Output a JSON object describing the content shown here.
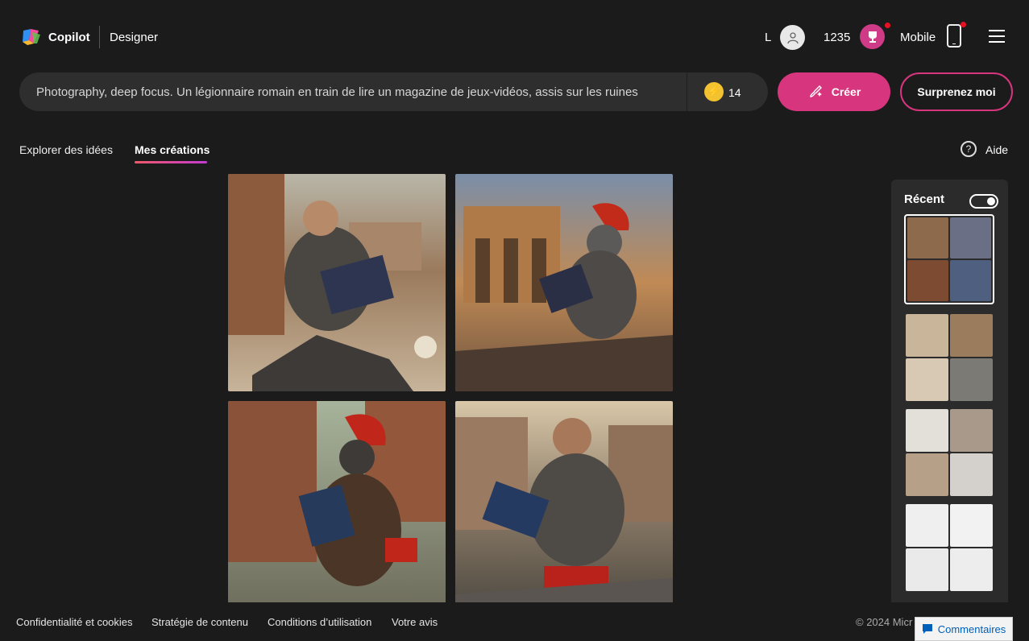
{
  "header": {
    "brand": "Copilot",
    "product": "Designer",
    "user_initial": "L",
    "points": "1235",
    "mobile_label": "Mobile"
  },
  "prompt": {
    "text": "Photography, deep focus. Un légionnaire romain en train de lire un magazine de jeux-vidéos, assis sur les ruines",
    "boosts": "14",
    "create_label": "Créer",
    "surprise_label": "Surprenez moi"
  },
  "tabs": [
    {
      "label": "Explorer des idées",
      "active": false
    },
    {
      "label": "Mes créations",
      "active": true
    }
  ],
  "help_label": "Aide",
  "recent": {
    "title": "Récent",
    "toggle_on": true
  },
  "footer": {
    "links": [
      "Confidentialité et cookies",
      "Stratégie de contenu",
      "Conditions d’utilisation",
      "Votre avis"
    ],
    "copyright": "© 2024 Micr",
    "feedback_label": "Commentaires"
  },
  "colors": {
    "accent": "#d7367f",
    "background": "#1b1b1b",
    "surface": "#2e2e2e"
  },
  "icons": [
    "copilot-logo",
    "user-icon",
    "trophy-icon",
    "phone-icon",
    "menu-icon",
    "lightning-icon",
    "paint-icon",
    "help-icon",
    "feedback-icon"
  ]
}
